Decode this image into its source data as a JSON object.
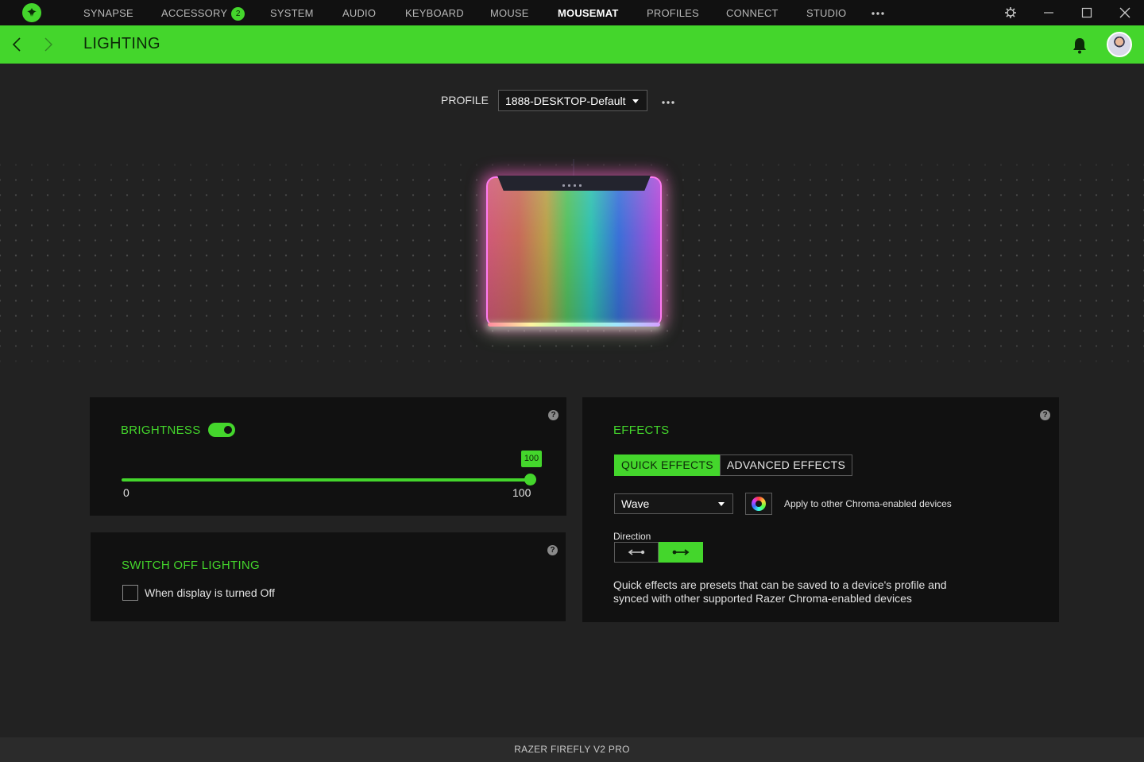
{
  "nav": {
    "items": [
      {
        "label": "SYNAPSE"
      },
      {
        "label": "ACCESSORY",
        "badge": "2"
      },
      {
        "label": "SYSTEM"
      },
      {
        "label": "AUDIO"
      },
      {
        "label": "KEYBOARD"
      },
      {
        "label": "MOUSE"
      },
      {
        "label": "MOUSEMAT",
        "active": true
      },
      {
        "label": "PROFILES"
      },
      {
        "label": "CONNECT"
      },
      {
        "label": "STUDIO"
      }
    ],
    "more_icon": "more-horizontal-icon"
  },
  "window_controls": {
    "settings_icon": "gear-icon",
    "minimize_icon": "minimize-icon",
    "maximize_icon": "maximize-icon",
    "close_icon": "close-icon"
  },
  "header": {
    "title": "LIGHTING",
    "accent_color": "#44d62c"
  },
  "profile": {
    "label": "PROFILE",
    "selected": "1888-DESKTOP-Default"
  },
  "brightness": {
    "title": "BRIGHTNESS",
    "enabled": true,
    "value": "100",
    "min_label": "0",
    "max_label": "100",
    "level": 1.0
  },
  "switch_off": {
    "title": "SWITCH OFF LIGHTING",
    "checkbox_label": "When display is turned Off",
    "checked": false
  },
  "effects": {
    "title": "EFFECTS",
    "tabs": [
      {
        "label": "QUICK EFFECTS",
        "active": true
      },
      {
        "label": "ADVANCED EFFECTS",
        "active": false
      }
    ],
    "selected_effect": "Wave",
    "apply_label": "Apply to other Chroma-enabled devices",
    "direction_label": "Direction",
    "direction_selected": "right",
    "description": "Quick effects are presets that can be saved to a device's profile and synced with other supported Razer Chroma-enabled devices"
  },
  "help_glyph": "?",
  "footer": {
    "device_name": "RAZER FIREFLY V2 PRO"
  }
}
